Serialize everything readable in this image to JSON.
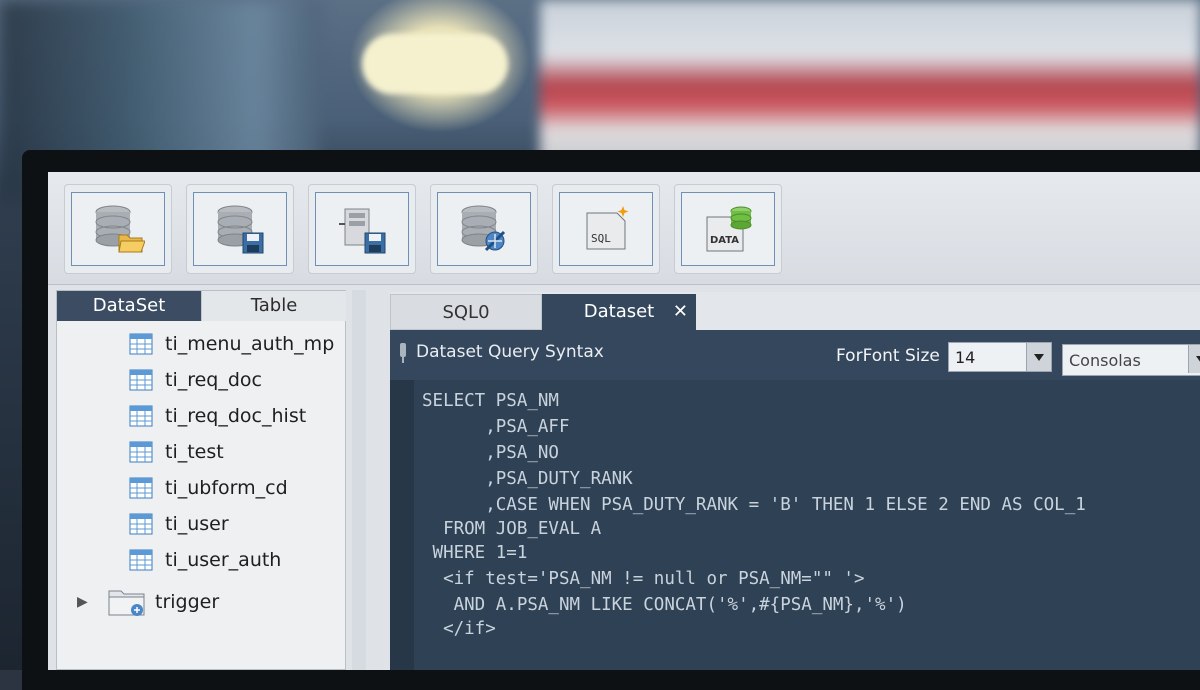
{
  "toolbar": {
    "buttons": [
      {
        "icon": "database-open-icon"
      },
      {
        "icon": "database-save-icon"
      },
      {
        "icon": "server-save-icon"
      },
      {
        "icon": "database-connect-icon"
      },
      {
        "icon": "sql-new-icon",
        "text": "SQL"
      },
      {
        "icon": "data-db-icon",
        "text": "DATA"
      }
    ]
  },
  "left_panel": {
    "tabs": [
      "DataSet",
      "Table"
    ],
    "active_tab": "DataSet",
    "items": [
      {
        "label": "ti_menu_auth_mp",
        "icon": "table-icon"
      },
      {
        "label": "ti_req_doc",
        "icon": "table-icon"
      },
      {
        "label": "ti_req_doc_hist",
        "icon": "table-icon"
      },
      {
        "label": "ti_test",
        "icon": "table-icon"
      },
      {
        "label": "ti_ubform_cd",
        "icon": "table-icon"
      },
      {
        "label": "ti_user",
        "icon": "table-icon"
      },
      {
        "label": "ti_user_auth",
        "icon": "table-icon"
      }
    ],
    "folder": {
      "label": "trigger",
      "icon": "folder-icon",
      "expanded": false
    }
  },
  "editor": {
    "tabs": [
      {
        "label": "SQL0",
        "active": false
      },
      {
        "label": "Dataset",
        "active": true,
        "close": "✕"
      }
    ],
    "header_title": "Dataset Query Syntax",
    "font_size_label": "ForFont Size",
    "font_size_value": "14",
    "font_name_value": "Consolas",
    "code_lines": [
      "SELECT PSA_NM",
      "      ,PSA_AFF",
      "      ,PSA_NO",
      "      ,PSA_DUTY_RANK",
      "      ,CASE WHEN PSA_DUTY_RANK = 'B' THEN 1 ELSE 2 END AS COL_1",
      "  FROM JOB_EVAL A",
      " WHERE 1=1",
      "  <if test='PSA_NM != null or PSA_NM=\"\" '>",
      "   AND A.PSA_NM LIKE CONCAT('%',#{PSA_NM},'%')",
      "  </if>"
    ]
  },
  "colors": {
    "tab_active": "#3c4d63",
    "editor_bg": "#2f4154",
    "code_text": "#c9d3dd"
  }
}
